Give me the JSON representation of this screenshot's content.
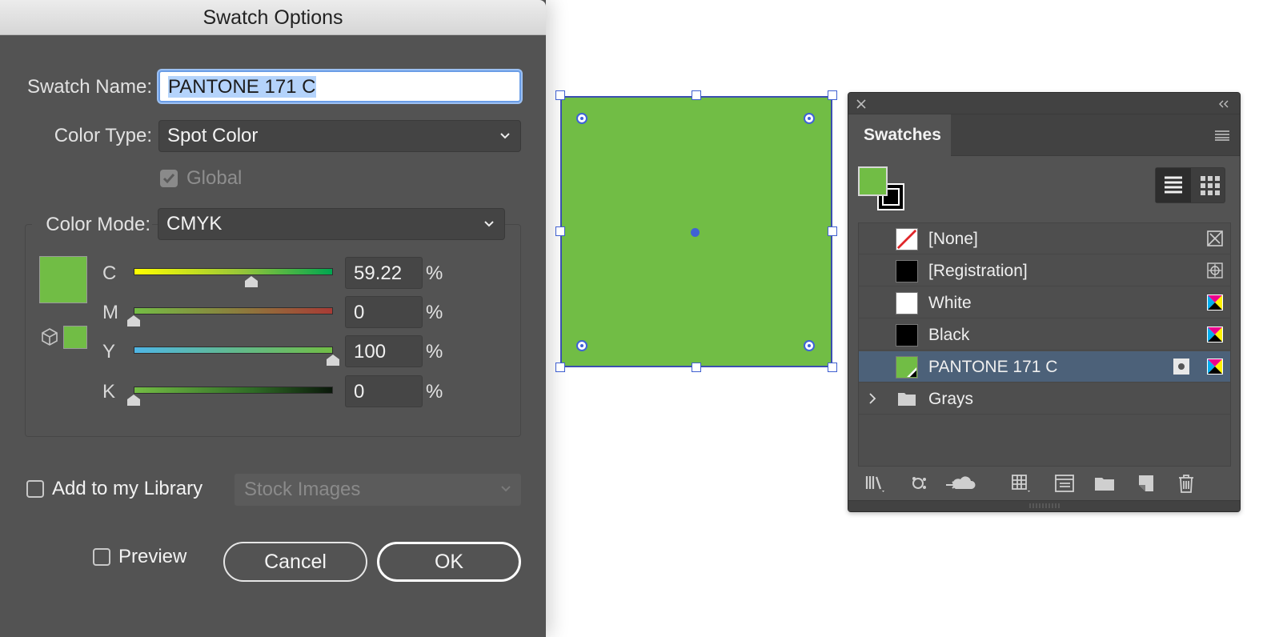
{
  "dialog": {
    "title": "Swatch Options",
    "swatch_name_label": "Swatch Name:",
    "swatch_name_value": "PANTONE 171 C",
    "color_type_label": "Color Type:",
    "color_type_value": "Spot Color",
    "global_label": "Global",
    "global_checked": true,
    "color_mode_label": "Color Mode:",
    "color_mode_value": "CMYK",
    "channels": [
      {
        "letter": "C",
        "value": "59.22",
        "unit": "%",
        "fraction": 0.5922
      },
      {
        "letter": "M",
        "value": "0",
        "unit": "%",
        "fraction": 0
      },
      {
        "letter": "Y",
        "value": "100",
        "unit": "%",
        "fraction": 1
      },
      {
        "letter": "K",
        "value": "0",
        "unit": "%",
        "fraction": 0
      }
    ],
    "add_library_label": "Add to my Library",
    "library_dropdown_value": "Stock Images",
    "preview_label": "Preview",
    "cancel_label": "Cancel",
    "ok_label": "OK"
  },
  "colors": {
    "swatch_green": "#71bd45",
    "selection_blue": "#3f5fd0",
    "dialog_bg": "#535353",
    "selected_row": "#4c6179"
  },
  "panel": {
    "tab_label": "Swatches",
    "close_icon": "close-icon",
    "collapse_icon": "double-chevron-left-icon",
    "menu_icon": "hamburger-menu-icon",
    "view_modes": [
      "list-view-icon",
      "grid-view-icon"
    ],
    "swatches": [
      {
        "label": "[None]",
        "chip": "none-icon",
        "type_icon": "no-color-type-icon"
      },
      {
        "label": "[Registration]",
        "chip": "#000000",
        "type_icon": "registration-type-icon"
      },
      {
        "label": "White",
        "chip": "#ffffff",
        "type_icon": "process-color-icon"
      },
      {
        "label": "Black",
        "chip": "#000000",
        "type_icon": "process-color-icon"
      },
      {
        "label": "PANTONE 171 C",
        "chip": "#71bd45",
        "type_icon": "process-color-icon",
        "spot_icon": "spot-color-icon",
        "selected": true
      },
      {
        "label": "Grays",
        "chip": "folder-icon",
        "group": true
      }
    ],
    "toolbar": [
      "swatch-libraries-menu-icon",
      "show-swatch-kinds-icon",
      "add-to-library-cloud-icon",
      "new-color-group-icon",
      "swatch-options-icon",
      "new-folder-icon",
      "new-swatch-icon",
      "delete-swatch-icon"
    ]
  }
}
